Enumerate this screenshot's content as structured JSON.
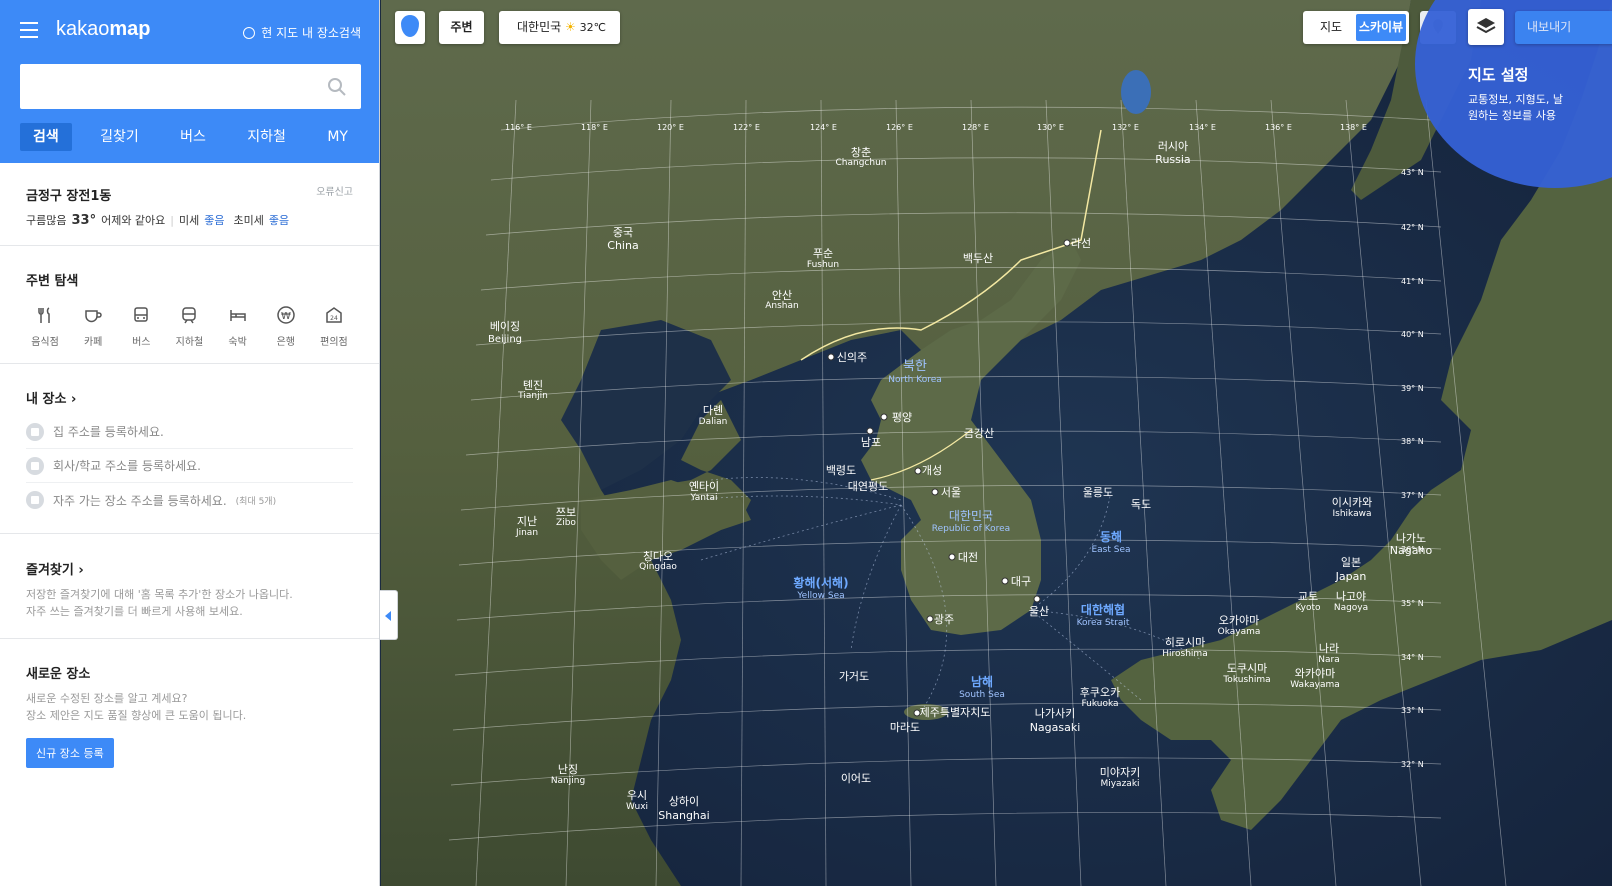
{
  "app": {
    "logo_light": "kakao",
    "logo_bold": "map"
  },
  "header": {
    "area_search_label": "현 지도 내 장소검색",
    "search_placeholder": "",
    "tabs": [
      {
        "label": "검색",
        "active": true
      },
      {
        "label": "길찾기"
      },
      {
        "label": "버스"
      },
      {
        "label": "지하철"
      },
      {
        "label": "MY"
      }
    ]
  },
  "weather": {
    "location": "금정구 장전1동",
    "report_label": "오류신고",
    "condition": "구름많음",
    "temp": "33°",
    "compare": "어제와 같아요",
    "pm10_label": "미세",
    "pm10_value": "좋음",
    "pm25_label": "초미세",
    "pm25_value": "좋음"
  },
  "nearby": {
    "title": "주변 탐색",
    "categories": [
      {
        "label": "음식점",
        "icon": "restaurant-icon"
      },
      {
        "label": "카페",
        "icon": "cafe-icon"
      },
      {
        "label": "버스",
        "icon": "bus-icon"
      },
      {
        "label": "지하철",
        "icon": "subway-icon"
      },
      {
        "label": "숙박",
        "icon": "hotel-icon"
      },
      {
        "label": "은행",
        "icon": "bank-icon"
      },
      {
        "label": "편의점",
        "icon": "convenience-store-icon"
      }
    ]
  },
  "my_places": {
    "title": "내 장소",
    "items": [
      {
        "label": "집 주소를 등록하세요.",
        "sub": ""
      },
      {
        "label": "회사/학교 주소를 등록하세요.",
        "sub": ""
      },
      {
        "label": "자주 가는 장소 주소를 등록하세요.",
        "sub": "(최대 5개)"
      }
    ]
  },
  "favorites": {
    "title": "즐겨찾기",
    "desc1": "저장한 즐겨찾기에 대해 '홈 목록 추가'한 장소가 나옵니다.",
    "desc2": "자주 쓰는 즐겨찾기를 더 빠르게 사용해 보세요."
  },
  "new_place": {
    "title": "새로운 장소",
    "desc1": "새로운 수정된 장소를 알고 계세요?",
    "desc2": "장소 제안은 지도 품질 향상에 큰 도움이 됩니다.",
    "button_label": "신규 장소 등록"
  },
  "map_controls": {
    "nearby_label": "주변",
    "weather_label": "대한민국",
    "weather_temp": "32℃",
    "map_label": "지도",
    "skyview_label": "스카이뷰",
    "export_label": "내보내기",
    "settings_title": "지도 설정",
    "settings_desc1": "교통정보, 지형도, 날",
    "settings_desc2": "원하는 정보를 사용"
  },
  "map": {
    "longitudes": [
      "116° E",
      "118° E",
      "120° E",
      "122° E",
      "124° E",
      "126° E",
      "128° E",
      "130° E",
      "132° E",
      "134° E",
      "136° E",
      "138° E"
    ],
    "latitudes": [
      "43° N",
      "42° N",
      "41° N",
      "40° N",
      "39° N",
      "38° N",
      "37° N",
      "36° N",
      "35° N",
      "34° N",
      "33° N",
      "32° N"
    ],
    "cities": [
      {
        "ko": "창춘",
        "en": "Changchun"
      },
      {
        "ko": "러시아",
        "en": "Russia"
      },
      {
        "ko": "중국",
        "en": "China"
      },
      {
        "ko": "푸순",
        "en": "Fushun"
      },
      {
        "ko": "라선",
        "en": ""
      },
      {
        "ko": "백두산",
        "en": ""
      },
      {
        "ko": "안산",
        "en": "Anshan"
      },
      {
        "ko": "베이징",
        "en": "Beijing"
      },
      {
        "ko": "신의주",
        "en": ""
      },
      {
        "ko": "북한",
        "en": "North Korea"
      },
      {
        "ko": "톈진",
        "en": "Tianjin"
      },
      {
        "ko": "다롄",
        "en": "Dalian"
      },
      {
        "ko": "평양",
        "en": ""
      },
      {
        "ko": "남포",
        "en": ""
      },
      {
        "ko": "금강산",
        "en": ""
      },
      {
        "ko": "백령도",
        "en": ""
      },
      {
        "ko": "개성",
        "en": ""
      },
      {
        "ko": "대연평도",
        "en": ""
      },
      {
        "ko": "서울",
        "en": ""
      },
      {
        "ko": "옌타이",
        "en": "Yantai"
      },
      {
        "ko": "울릉도",
        "en": ""
      },
      {
        "ko": "독도",
        "en": ""
      },
      {
        "ko": "쯔보",
        "en": "Zibo"
      },
      {
        "ko": "지난",
        "en": "Jinan"
      },
      {
        "ko": "대한민국",
        "en": "Republic of Korea"
      },
      {
        "ko": "칭다오",
        "en": "Qingdao"
      },
      {
        "ko": "대전",
        "en": ""
      },
      {
        "ko": "대구",
        "en": ""
      },
      {
        "ko": "울산",
        "en": ""
      },
      {
        "ko": "광주",
        "en": ""
      },
      {
        "ko": "가거도",
        "en": ""
      },
      {
        "ko": "제주특별자치도",
        "en": ""
      },
      {
        "ko": "마라도",
        "en": ""
      },
      {
        "ko": "나가사키",
        "en": "Nagasaki"
      },
      {
        "ko": "후쿠오카",
        "en": "Fukuoka"
      },
      {
        "ko": "히로시마",
        "en": "Hiroshima"
      },
      {
        "ko": "오카야마",
        "en": "Okayama"
      },
      {
        "ko": "교토",
        "en": "Kyoto"
      },
      {
        "ko": "나고야",
        "en": "Nagoya"
      },
      {
        "ko": "나라",
        "en": "Nara"
      },
      {
        "ko": "와카야마",
        "en": "Wakayama"
      },
      {
        "ko": "도쿠시마",
        "en": "Tokushima"
      },
      {
        "ko": "일본",
        "en": "Japan"
      },
      {
        "ko": "나가노",
        "en": "Nagano"
      },
      {
        "ko": "이시카와",
        "en": "Ishikawa"
      },
      {
        "ko": "미야자키",
        "en": "Miyazaki"
      },
      {
        "ko": "난징",
        "en": "Nanjing"
      },
      {
        "ko": "우시",
        "en": "Wuxi"
      },
      {
        "ko": "상하이",
        "en": "Shanghai"
      },
      {
        "ko": "이어도",
        "en": ""
      }
    ],
    "seas": [
      {
        "ko": "황해(서해)",
        "en": "Yellow Sea"
      },
      {
        "ko": "동해",
        "en": "East Sea"
      },
      {
        "ko": "대한해협",
        "en": "Korea Strait"
      },
      {
        "ko": "남해",
        "en": "South Sea"
      }
    ]
  },
  "colors": {
    "accent": "#3d8af7",
    "sea": "#1b2a3f",
    "land": "#5b6a4a"
  }
}
